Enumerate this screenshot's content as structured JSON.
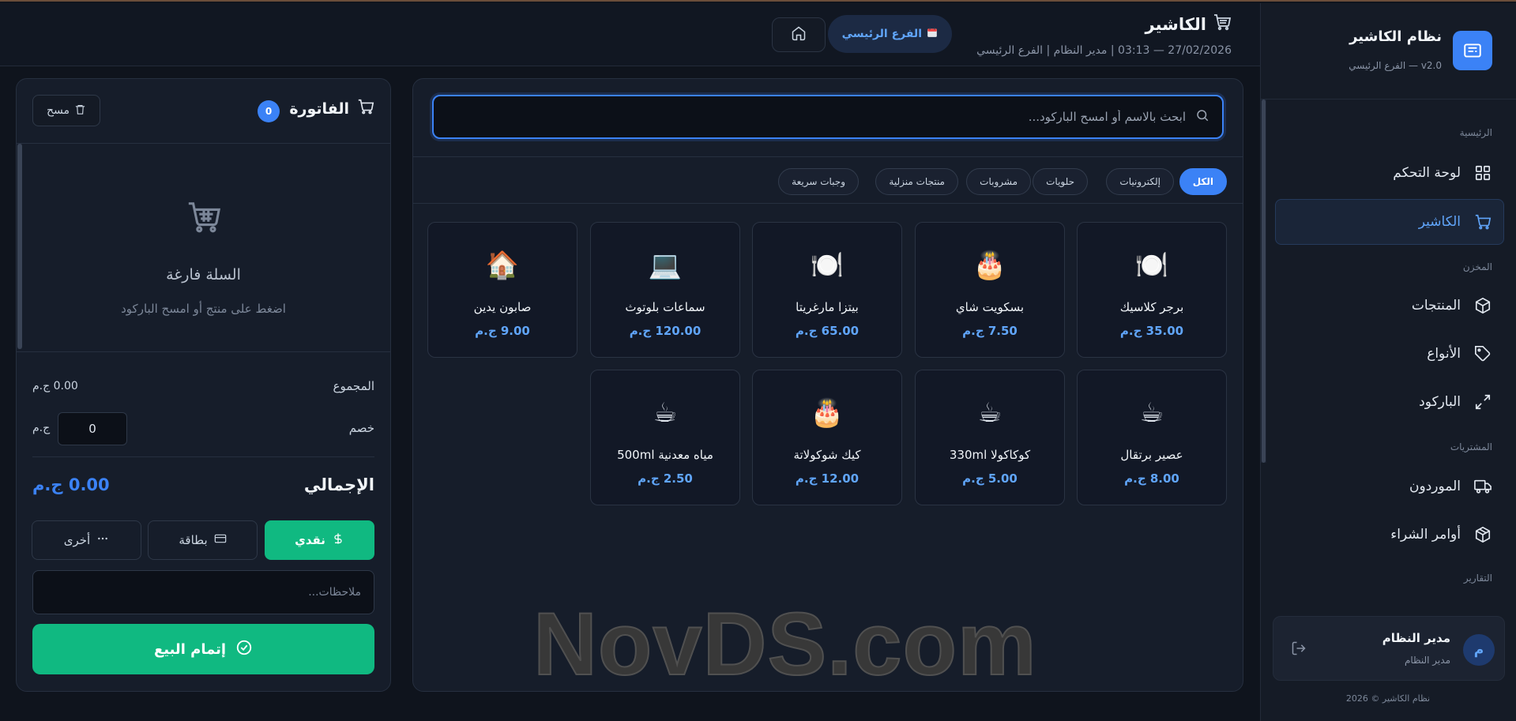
{
  "sidebar": {
    "brand_title": "نظام الكاشير",
    "brand_sub": "v2.0 — الفرع الرئيسي",
    "sections": [
      {
        "label": "الرئيسية"
      },
      {
        "label": "المخزن"
      },
      {
        "label": "المشتريات"
      },
      {
        "label": "التقارير"
      }
    ],
    "items": [
      {
        "label": "لوحة التحكم",
        "icon": "grid-icon"
      },
      {
        "label": "الكاشير",
        "icon": "cart-icon",
        "active": true
      },
      {
        "label": "المنتجات",
        "icon": "box-icon"
      },
      {
        "label": "الأنواع",
        "icon": "tag-icon"
      },
      {
        "label": "الباركود",
        "icon": "expand-icon"
      },
      {
        "label": "الموردون",
        "icon": "truck-icon"
      },
      {
        "label": "أوامر الشراء",
        "icon": "package-icon"
      }
    ],
    "user": {
      "avatar": "م",
      "name": "مدير النظام",
      "role": "مدير النظام"
    },
    "copyright": "نظام الكاشير © 2026"
  },
  "header": {
    "title": "الكاشير",
    "meta": "27/02/2026 — 03:13 | مدير النظام | الفرع الرئيسي",
    "branch": "الفرع الرئيسي"
  },
  "search": {
    "placeholder": "ابحث بالاسم أو امسح الباركود..."
  },
  "categories": [
    "الكل",
    "إلكترونيات",
    "حلويات",
    "مشروبات",
    "منتجات منزلية",
    "وجبات سريعة"
  ],
  "products": [
    {
      "name": "برجر كلاسيك",
      "price": "35.00 ج.م",
      "emoji": "🍽️"
    },
    {
      "name": "بسكويت شاي",
      "price": "7.50 ج.م",
      "emoji": "🎂"
    },
    {
      "name": "بيتزا مارغريتا",
      "price": "65.00 ج.م",
      "emoji": "🍽️"
    },
    {
      "name": "سماعات بلوتوث",
      "price": "120.00 ج.م",
      "emoji": "💻"
    },
    {
      "name": "صابون يدين",
      "price": "9.00 ج.م",
      "emoji": "🏠"
    },
    {
      "name": "عصير برتقال",
      "price": "8.00 ج.م",
      "emoji": "☕"
    },
    {
      "name": "كوكاكولا 330ml",
      "price": "5.00 ج.م",
      "emoji": "☕"
    },
    {
      "name": "كيك شوكولاتة",
      "price": "12.00 ج.م",
      "emoji": "🎂"
    },
    {
      "name": "مياه معدنية 500ml",
      "price": "2.50 ج.م",
      "emoji": "☕"
    }
  ],
  "invoice": {
    "title": "الفاتورة",
    "count": "0",
    "clear_label": "مسح",
    "empty_title": "السلة فارغة",
    "empty_sub": "اضغط على منتج أو امسح الباركود",
    "subtotal_label": "المجموع",
    "subtotal_value": "0.00 ج.م",
    "discount_label": "خصم",
    "discount_value": "0",
    "discount_unit": "ج.م",
    "total_label": "الإجمالي",
    "total_value": "0.00 ج.م",
    "pay_methods": [
      {
        "label": "نقدي",
        "icon": "dollar-icon",
        "active": true
      },
      {
        "label": "بطاقة",
        "icon": "card-icon"
      },
      {
        "label": "أخرى",
        "icon": "more-icon"
      }
    ],
    "notes_placeholder": "ملاحظات...",
    "complete_label": "إتمام البيع"
  },
  "watermark": "NovDS.com",
  "colors": {
    "accent": "#3b82f6",
    "success": "#10b981",
    "bg": "#0f141d"
  }
}
